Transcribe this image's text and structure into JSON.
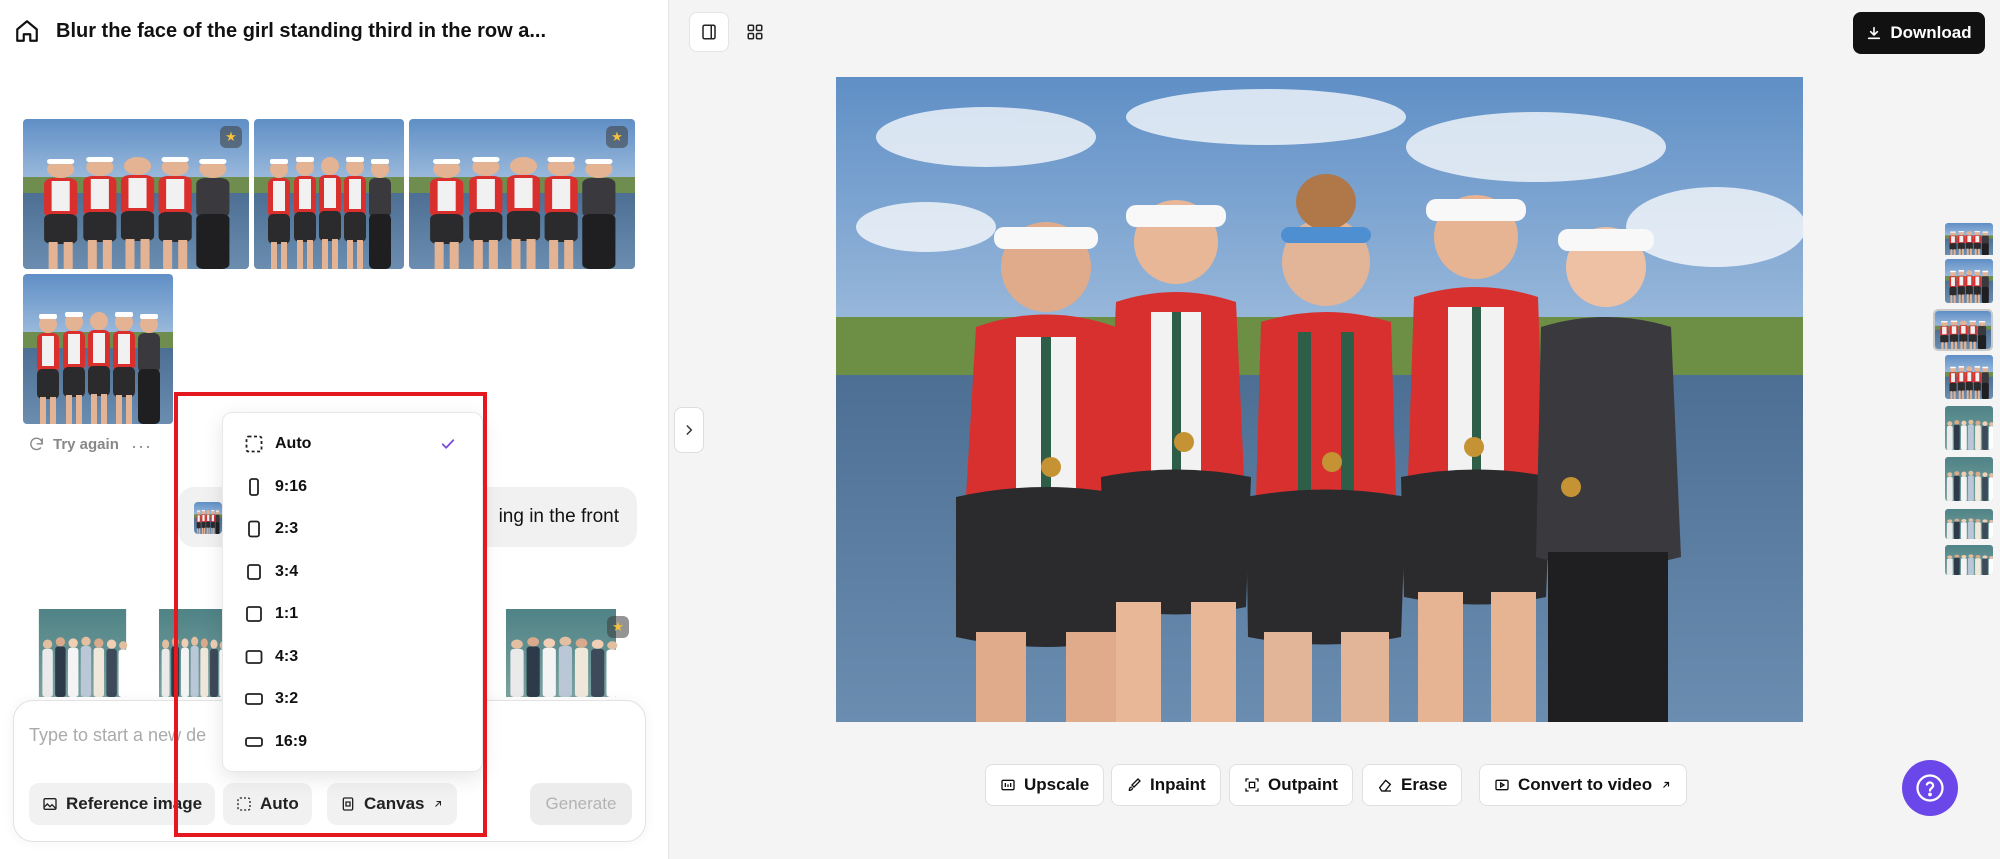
{
  "header": {
    "title": "Blur the face of the girl standing third in the row a..."
  },
  "conversation": {
    "try_again_label": "Try again",
    "more_label": "···",
    "user_message_text": "ing in the front"
  },
  "composer": {
    "placeholder": "Type to start a new de",
    "reference_label": "Reference image",
    "aspect_label": "Auto",
    "canvas_label": "Canvas",
    "generate_label": "Generate"
  },
  "aspect_menu": {
    "selected": "Auto",
    "items": [
      {
        "label": "Auto",
        "icon": "dashed-square-icon"
      },
      {
        "label": "9:16",
        "icon": "portrait-tall-icon"
      },
      {
        "label": "2:3",
        "icon": "portrait-icon"
      },
      {
        "label": "3:4",
        "icon": "portrait-wide-icon"
      },
      {
        "label": "1:1",
        "icon": "square-icon"
      },
      {
        "label": "4:3",
        "icon": "landscape-icon"
      },
      {
        "label": "3:2",
        "icon": "landscape-wide-icon"
      },
      {
        "label": "16:9",
        "icon": "landscape-widest-icon"
      }
    ]
  },
  "toolbar": {
    "download_label": "Download",
    "upscale_label": "Upscale",
    "inpaint_label": "Inpaint",
    "outpaint_label": "Outpaint",
    "erase_label": "Erase",
    "convert_label": "Convert to video"
  },
  "colors": {
    "accent": "#6b46e8",
    "check": "#7c4ddb",
    "highlight": "#e3191f",
    "download_bg": "#111111"
  }
}
